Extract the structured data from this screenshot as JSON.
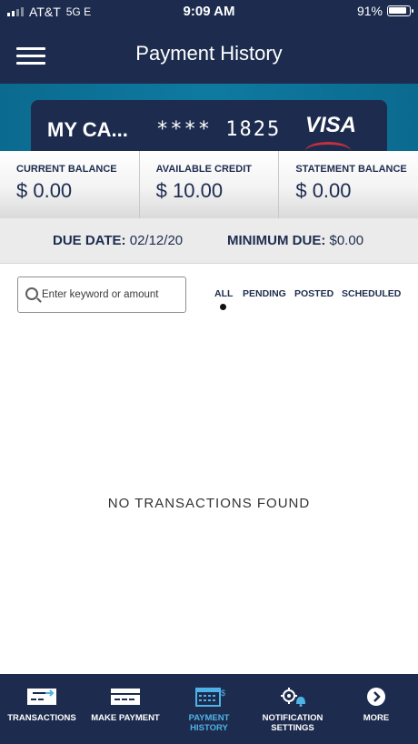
{
  "status_bar": {
    "carrier": "AT&T",
    "network": "5G E",
    "time": "9:09 AM",
    "battery": "91%"
  },
  "header": {
    "title": "Payment History"
  },
  "card": {
    "name": "MY CA...",
    "masked_number": "**** 1825",
    "brand": "VISA"
  },
  "balances": [
    {
      "label": "CURRENT BALANCE",
      "value": "$ 0.00"
    },
    {
      "label": "AVAILABLE CREDIT",
      "value": "$ 10.00"
    },
    {
      "label": "STATEMENT BALANCE",
      "value": "$ 0.00"
    }
  ],
  "due": {
    "due_label": "DUE DATE:",
    "due_value": "02/12/20",
    "min_label": "MINIMUM DUE:",
    "min_value": "$0.00"
  },
  "search": {
    "placeholder": "Enter keyword or amount",
    "value": ""
  },
  "filters": {
    "all": "ALL",
    "pending": "PENDING",
    "posted": "POSTED",
    "scheduled": "SCHEDULED",
    "selected": "ALL"
  },
  "main": {
    "empty_message": "NO TRANSACTIONS FOUND"
  },
  "bottom_nav": {
    "transactions": "TRANSACTIONS",
    "make_payment": "MAKE PAYMENT",
    "payment_history_1": "PAYMENT",
    "payment_history_2": "HISTORY",
    "notification_1": "NOTIFICATION",
    "notification_2": "SETTINGS",
    "more": "MORE"
  },
  "colors": {
    "navy": "#1d2c4e",
    "teal_band": "#0f7aa0",
    "active_tab": "#4fb2e6",
    "card_accent": "#c62f3c"
  },
  "icons": [
    "menu-icon",
    "signal-icon",
    "battery-icon",
    "search-icon",
    "transactions-icon",
    "card-icon",
    "calendar-icon",
    "gear-bell-icon",
    "chevron-right-icon"
  ]
}
